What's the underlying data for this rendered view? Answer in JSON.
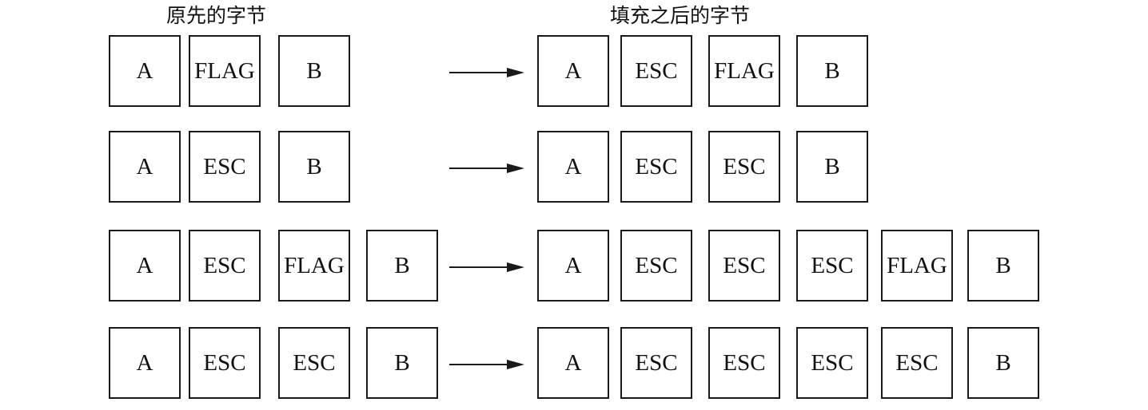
{
  "headings": {
    "original": "原先的字节",
    "stuffed": "填充之后的字节"
  },
  "rows": [
    {
      "original": [
        "A",
        "FLAG",
        "B"
      ],
      "stuffed": [
        "A",
        "ESC",
        "FLAG",
        "B"
      ]
    },
    {
      "original": [
        "A",
        "ESC",
        "B"
      ],
      "stuffed": [
        "A",
        "ESC",
        "ESC",
        "B"
      ]
    },
    {
      "original": [
        "A",
        "ESC",
        "FLAG",
        "B"
      ],
      "stuffed": [
        "A",
        "ESC",
        "ESC",
        "ESC",
        "FLAG",
        "B"
      ]
    },
    {
      "original": [
        "A",
        "ESC",
        "ESC",
        "B"
      ],
      "stuffed": [
        "A",
        "ESC",
        "ESC",
        "ESC",
        "ESC",
        "B"
      ]
    }
  ]
}
